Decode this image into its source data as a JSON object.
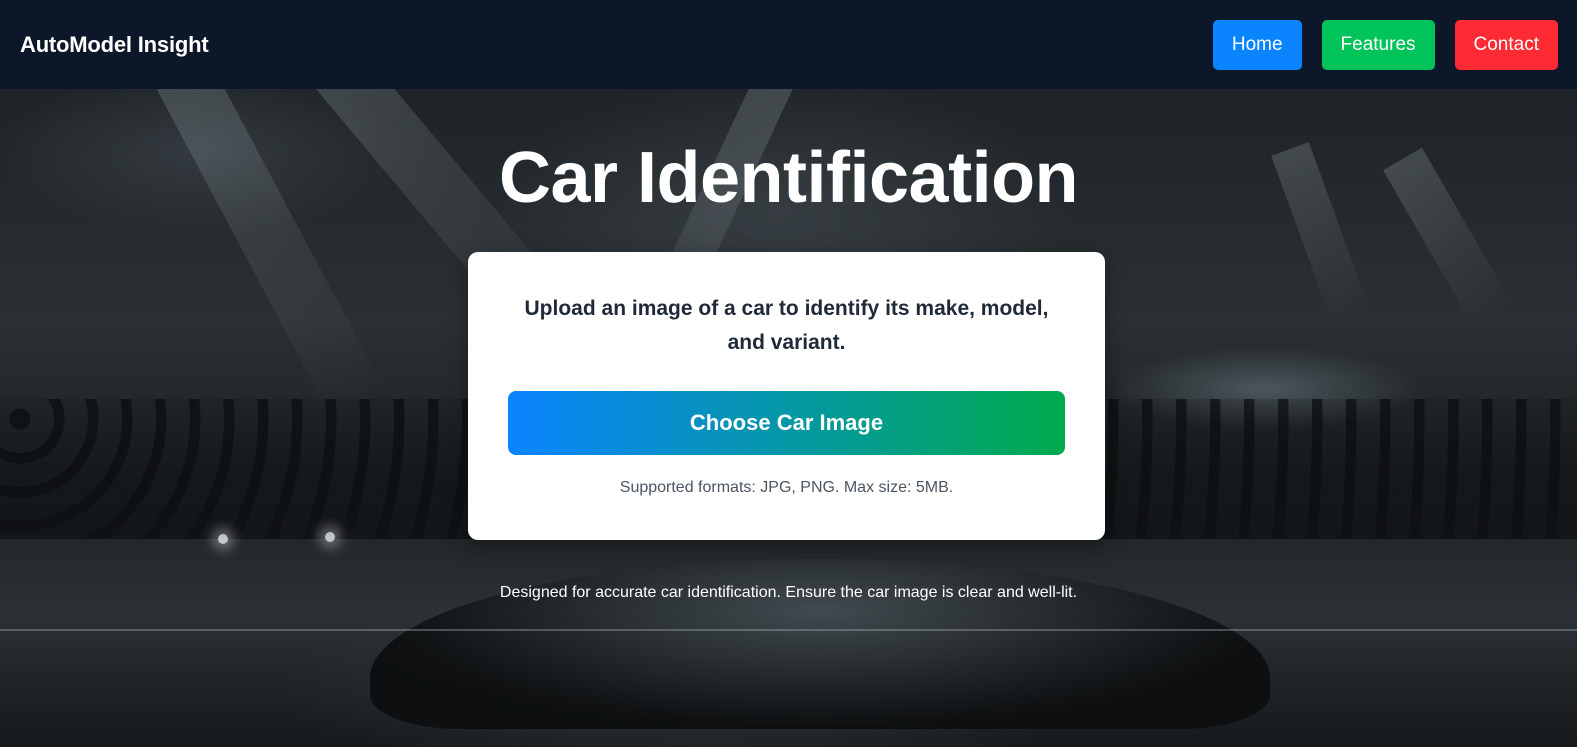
{
  "header": {
    "brand": "AutoModel Insight",
    "nav": [
      {
        "label": "Home",
        "color": "#0b84ff"
      },
      {
        "label": "Features",
        "color": "#00c35a"
      },
      {
        "label": "Contact",
        "color": "#ff2b34"
      }
    ]
  },
  "hero": {
    "title": "Car Identification",
    "card": {
      "description": "Upload an image of a car to identify its make, model, and variant.",
      "upload_button_label": "Choose Car Image",
      "upload_button_gradient": [
        "#0a84ff",
        "#00aa4c"
      ],
      "formats_note": "Supported formats: JPG, PNG. Max size: 5MB."
    },
    "footer_note": "Designed for accurate car identification. Ensure the car image is clear and well-lit."
  },
  "colors": {
    "navbar_bg": "#0d172a",
    "card_bg": "#ffffff",
    "text_dark": "#1f2937"
  }
}
